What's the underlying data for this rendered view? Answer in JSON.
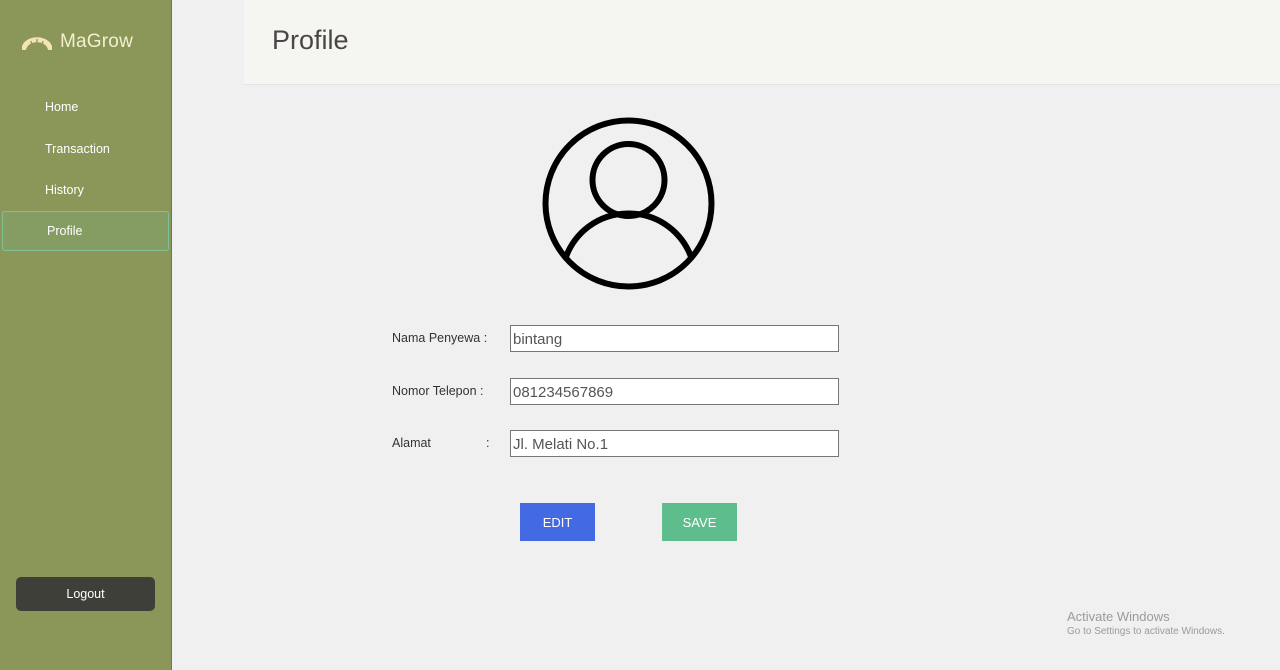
{
  "app": {
    "name": "MaGrow"
  },
  "sidebar": {
    "items": [
      {
        "label": "Home"
      },
      {
        "label": "Transaction"
      },
      {
        "label": "History"
      },
      {
        "label": "Profile"
      }
    ],
    "active": "Profile",
    "logout_label": "Logout"
  },
  "header": {
    "title": "Profile"
  },
  "form": {
    "name_label": "Nama Penyewa :",
    "name_value": "bintang",
    "phone_label": "Nomor Telepon :",
    "phone_value": "081234567869",
    "address_label": "Alamat",
    "address_colon": ":",
    "address_value": "Jl. Melati No.1"
  },
  "buttons": {
    "edit_label": "EDIT",
    "save_label": "SAVE"
  },
  "watermark": {
    "title": "Activate Windows",
    "subtitle": "Go to Settings to activate Windows."
  },
  "icons": {
    "logo": "magrow-logo-icon",
    "avatar": "user-avatar-icon"
  },
  "colors": {
    "sidebar": "#8a9758",
    "active_item_border": "#7fc29a",
    "edit_button": "#4369e3",
    "save_button": "#5ebd8d",
    "logout_button": "#3e3f38",
    "brand_text": "#f3efcf"
  }
}
